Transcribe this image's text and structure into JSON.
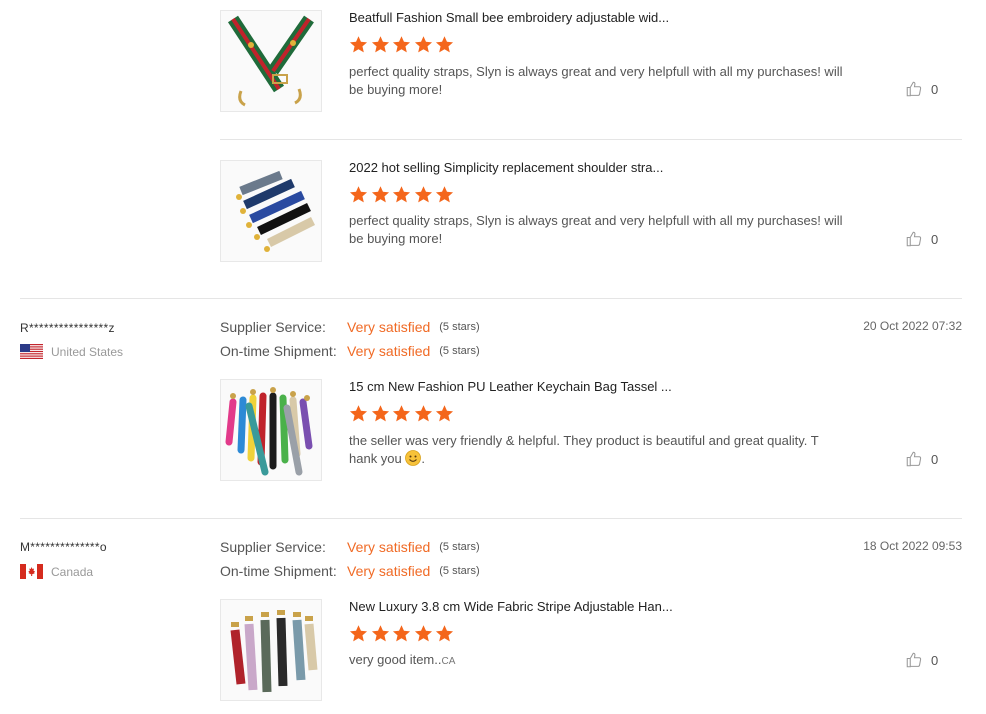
{
  "colors": {
    "accent": "#f06a25",
    "star": "#f4661b",
    "divider": "#e5e5e5"
  },
  "reviews_top": [
    {
      "product_title": "Beatfull Fashion Small bee embroidery adjustable wid...",
      "stars": 5,
      "text": "perfect quality straps, Slyn is always great and very helpfull with all my purchases! will be buying more!",
      "likes": "0"
    },
    {
      "product_title": "2022 hot selling Simplicity replacement shoulder stra...",
      "stars": 5,
      "text": "perfect quality straps, Slyn is always great and very helpfull with all my purchases! will be buying more!",
      "likes": "0"
    }
  ],
  "reviewers": [
    {
      "name": "R****************z",
      "country": "United States",
      "flag_icon": "us-flag-icon",
      "date": "20 Oct 2022 07:32",
      "supplier_label": "Supplier Service:",
      "supplier_value": "Very satisfied",
      "supplier_stars": "(5 stars)",
      "shipment_label": "On-time Shipment:",
      "shipment_value": "Very satisfied",
      "shipment_stars": "(5 stars)",
      "product_title": "15 cm New Fashion PU Leather Keychain Bag Tassel ...",
      "stars": 5,
      "text": "the seller was very friendly & helpful. They product is beautiful and great quality. T hank you",
      "text_emoji": "smiling-face-emoji",
      "text_suffix": ".",
      "likes": "0"
    },
    {
      "name": "M**************o",
      "country": "Canada",
      "flag_icon": "canada-flag-icon",
      "date": "18 Oct 2022 09:53",
      "supplier_label": "Supplier Service:",
      "supplier_value": "Very satisfied",
      "supplier_stars": "(5 stars)",
      "shipment_label": "On-time Shipment:",
      "shipment_value": "Very satisfied",
      "shipment_stars": "(5 stars)",
      "product_title": "New Luxury 3.8 cm Wide Fabric Stripe Adjustable Han...",
      "stars": 5,
      "text": "very good item..",
      "text_suffix": "CA",
      "likes": "0"
    }
  ]
}
